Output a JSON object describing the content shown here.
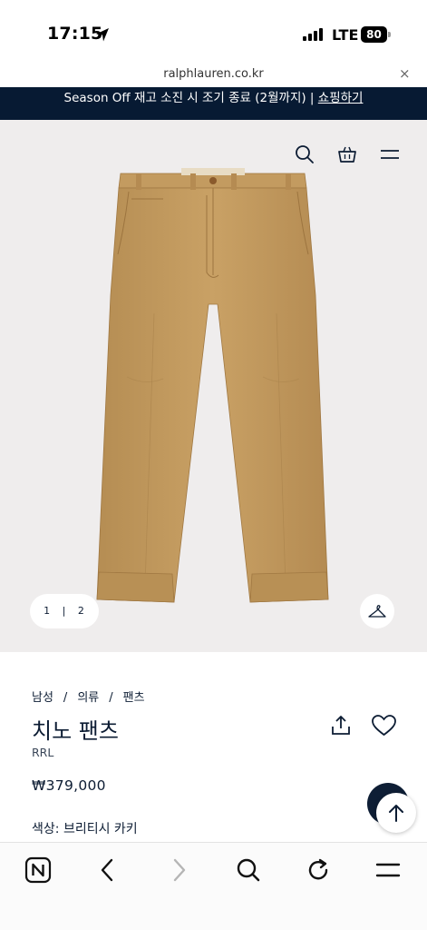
{
  "status_bar": {
    "time": "17:15",
    "network": "LTE",
    "battery": "80"
  },
  "url_bar": {
    "domain": "ralphlauren.co.kr",
    "close_symbol": "×"
  },
  "promo": {
    "text": "Season Off 재고 소진 시 조기 종료 (2월까지) | ",
    "link": "쇼핑하기"
  },
  "header_icons": [
    "search-icon",
    "bag-icon",
    "menu-icon"
  ],
  "gallery": {
    "pager_current": "1",
    "pager_separator": "|",
    "pager_total": "2"
  },
  "product": {
    "breadcrumb": [
      "남성",
      "의류",
      "팬츠"
    ],
    "breadcrumb_separator": "/",
    "title": "치노 팬츠",
    "brand": "RRL",
    "price": "₩379,000",
    "color_label": "색상:",
    "color_value": "브리티시 카키"
  },
  "colors": {
    "navy": "#071a33",
    "image_bg": "#efeded",
    "khaki": "#c49d62"
  },
  "toolbar_icons": [
    "naver-icon",
    "back-icon",
    "forward-icon",
    "search-icon",
    "refresh-icon",
    "menu-icon"
  ]
}
